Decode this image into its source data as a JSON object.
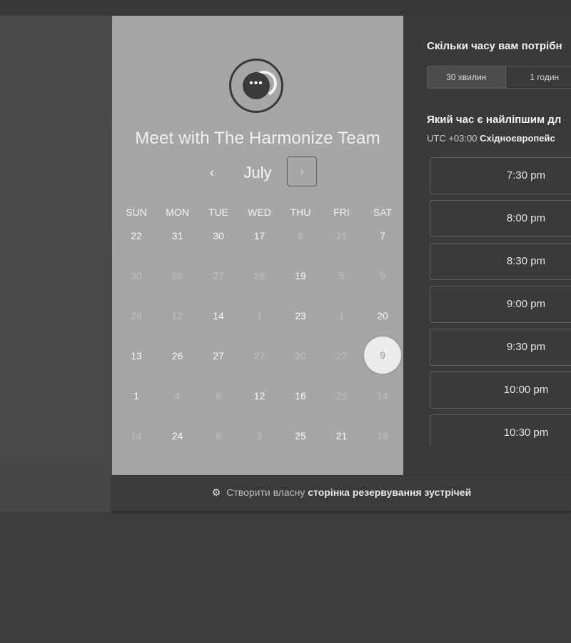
{
  "footer": {
    "prefix": "Створити власну",
    "link": "сторінка резервування зустрічей"
  },
  "calendar": {
    "title": "Meet with The Harmonize Team",
    "month": "July",
    "prev_label": "‹",
    "next_label": "›",
    "days_of_week": [
      "SUN",
      "MON",
      "TUE",
      "WED",
      "THU",
      "FRI",
      "SAT"
    ],
    "weeks": [
      [
        {
          "d": "22",
          "on": true
        },
        {
          "d": "31",
          "on": true
        },
        {
          "d": "30",
          "on": true
        },
        {
          "d": "17",
          "on": true
        },
        {
          "d": "8",
          "on": false
        },
        {
          "d": "21",
          "on": false
        },
        {
          "d": "7",
          "on": true
        }
      ],
      [
        {
          "d": "30",
          "on": false
        },
        {
          "d": "26",
          "on": false
        },
        {
          "d": "27",
          "on": false
        },
        {
          "d": "28",
          "on": false
        },
        {
          "d": "19",
          "on": true
        },
        {
          "d": "5",
          "on": false
        },
        {
          "d": "9",
          "on": false
        }
      ],
      [
        {
          "d": "28",
          "on": false
        },
        {
          "d": "12",
          "on": false
        },
        {
          "d": "14",
          "on": true
        },
        {
          "d": "1",
          "on": false
        },
        {
          "d": "23",
          "on": true
        },
        {
          "d": "1",
          "on": false
        },
        {
          "d": "20",
          "on": true
        }
      ],
      [
        {
          "d": "13",
          "on": true
        },
        {
          "d": "26",
          "on": true
        },
        {
          "d": "27",
          "on": true
        },
        {
          "d": "27",
          "on": false
        },
        {
          "d": "20",
          "on": false
        },
        {
          "d": "27",
          "on": false
        },
        {
          "d": "9",
          "on": true,
          "selected": true
        }
      ],
      [
        {
          "d": "1",
          "on": true
        },
        {
          "d": "4",
          "on": false
        },
        {
          "d": "6",
          "on": false
        },
        {
          "d": "12",
          "on": true
        },
        {
          "d": "16",
          "on": true
        },
        {
          "d": "29",
          "on": false
        },
        {
          "d": "14",
          "on": false
        }
      ],
      [
        {
          "d": "14",
          "on": false
        },
        {
          "d": "24",
          "on": true
        },
        {
          "d": "6",
          "on": false
        },
        {
          "d": "3",
          "on": false
        },
        {
          "d": "25",
          "on": true
        },
        {
          "d": "21",
          "on": true
        },
        {
          "d": "18",
          "on": false
        }
      ]
    ]
  },
  "booking": {
    "duration_question": "Скільки часу вам потрібн",
    "durations": [
      {
        "label": "30 хвилин",
        "active": true
      },
      {
        "label": "1 годин",
        "active": false
      }
    ],
    "time_question": "Який час є найліпшим дл",
    "timezone_prefix": "UTC +03:00",
    "timezone_name": "Східноєвропейс",
    "slots": [
      "7:30 pm",
      "8:00 pm",
      "8:30 pm",
      "9:00 pm",
      "9:30 pm",
      "10:00 pm",
      "10:30 pm"
    ]
  },
  "icons": {
    "avatar": "chat-bubble-icon",
    "footer": "hubspot-sprocket-icon"
  }
}
